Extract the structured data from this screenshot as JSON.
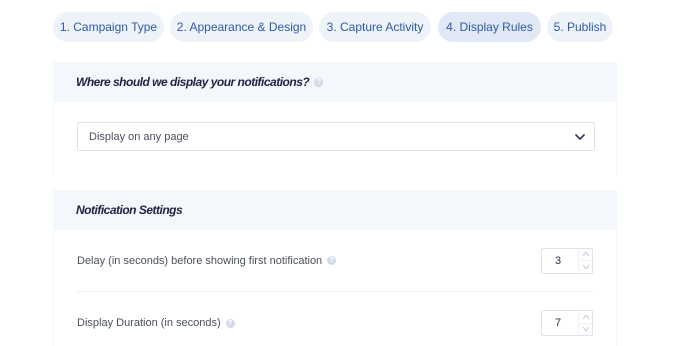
{
  "tabs": [
    {
      "label": "1. Campaign Type",
      "active": false
    },
    {
      "label": "2. Appearance & Design",
      "active": false
    },
    {
      "label": "3. Capture Activity",
      "active": false
    },
    {
      "label": "4. Display Rules",
      "active": true
    },
    {
      "label": "5. Publish",
      "active": false
    }
  ],
  "display_section": {
    "title": "Where should we display your notifications?",
    "select_value": "Display on any page"
  },
  "notification_settings": {
    "title": "Notification Settings",
    "delay": {
      "label": "Delay (in seconds) before showing first notification",
      "value": "3"
    },
    "duration": {
      "label": "Display Duration (in seconds)",
      "value": "7"
    }
  },
  "colors": {
    "tab_bg": "#eef3f9",
    "tab_active_bg": "#e1e9f6",
    "tab_text": "#2d5aa8",
    "panel_head_bg": "#f4f7fb"
  },
  "icons": {
    "help": "help-icon",
    "select_arrow": "chevron-down-icon",
    "step_up": "caret-up-icon",
    "step_down": "caret-down-icon"
  }
}
